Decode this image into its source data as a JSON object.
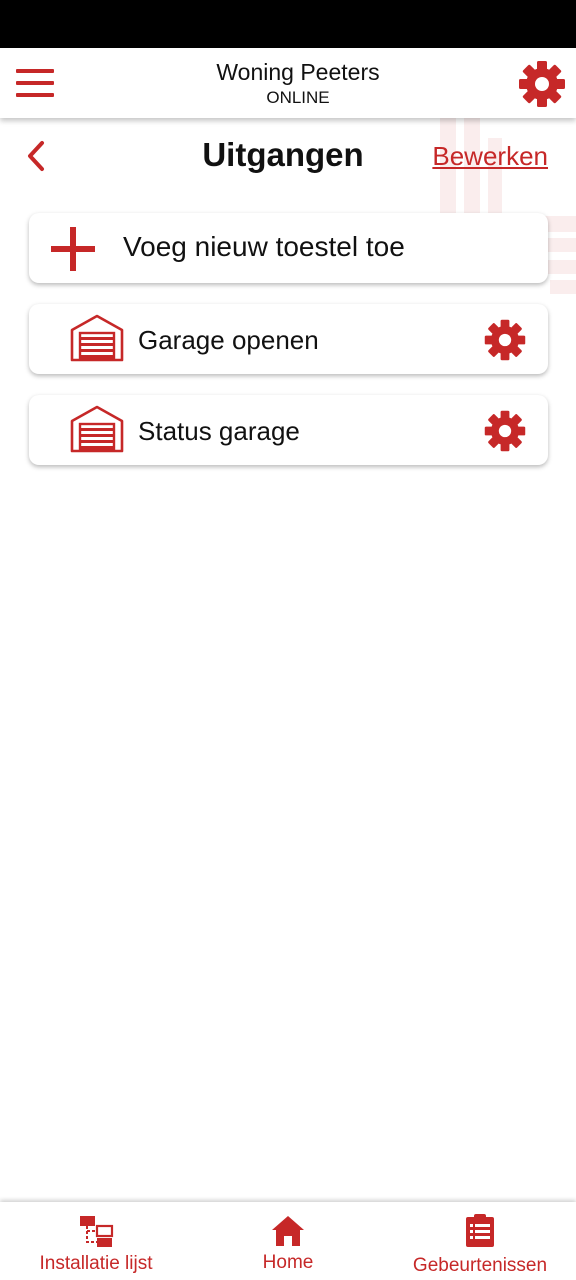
{
  "header": {
    "title": "Woning Peeters",
    "subtitle": "ONLINE",
    "menu_icon": "hamburger-menu-icon",
    "settings_icon": "gear-icon"
  },
  "page": {
    "title": "Uitgangen",
    "back_icon": "chevron-left-icon",
    "edit_label": "Bewerken"
  },
  "add_device": {
    "label": "Voeg nieuw toestel toe",
    "icon": "plus-icon"
  },
  "devices": [
    {
      "label": "Garage openen",
      "icon": "garage-door-icon",
      "settings_icon": "gear-icon"
    },
    {
      "label": "Status garage",
      "icon": "garage-door-icon",
      "settings_icon": "gear-icon"
    }
  ],
  "bottom_nav": [
    {
      "label": "Installatie lijst",
      "icon": "network-list-icon"
    },
    {
      "label": "Home",
      "icon": "home-icon"
    },
    {
      "label": "Gebeurtenissen",
      "icon": "clipboard-list-icon"
    }
  ],
  "colors": {
    "accent": "#c62828",
    "text": "#111111",
    "background": "#ffffff",
    "status_bar": "#000000"
  }
}
